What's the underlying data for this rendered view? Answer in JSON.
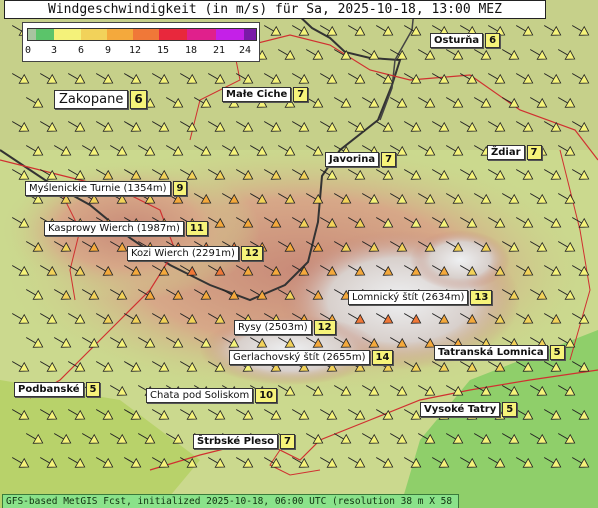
{
  "title": "Windgeschwindigkeit (in m/s) für Sa, 2025-10-18, 13:00 MEZ",
  "legend": {
    "ticks": [
      "0",
      "3",
      "6",
      "9",
      "12",
      "15",
      "18",
      "21",
      "24"
    ],
    "colors": [
      "#a8c4a0",
      "#5bc46a",
      "#f4f27a",
      "#f2d25a",
      "#f4a93c",
      "#f07838",
      "#e8283c",
      "#e0208c",
      "#c420e8",
      "#7a1aa8"
    ]
  },
  "places": [
    {
      "name": "Osturňa",
      "value": "6",
      "style": "bold"
    },
    {
      "name": "Zakopane",
      "value": "6",
      "style": "big"
    },
    {
      "name": "Małe Ciche",
      "value": "7",
      "style": "bold"
    },
    {
      "name": "Javorina",
      "value": "7",
      "style": "bold"
    },
    {
      "name": "Ždiar",
      "value": "7",
      "style": "bold"
    },
    {
      "name": "Myślenickie Turnie (1354m)",
      "value": "9",
      "style": "normal"
    },
    {
      "name": "Kasprowy Wierch (1987m)",
      "value": "11",
      "style": "normal"
    },
    {
      "name": "Kozi Wierch (2291m)",
      "value": "12",
      "style": "normal"
    },
    {
      "name": "Lomnický štít (2634m)",
      "value": "13",
      "style": "normal"
    },
    {
      "name": "Rysy (2503m)",
      "value": "12",
      "style": "normal"
    },
    {
      "name": "Gerlachovský štít (2655m)",
      "value": "14",
      "style": "normal"
    },
    {
      "name": "Tatranská Lomnica",
      "value": "5",
      "style": "bold"
    },
    {
      "name": "Podbanské",
      "value": "5",
      "style": "bold"
    },
    {
      "name": "Chata pod Soliskom",
      "value": "10",
      "style": "normal"
    },
    {
      "name": "Vysoké Tatry",
      "value": "5",
      "style": "bold"
    },
    {
      "name": "Štrbské Pleso",
      "value": "7",
      "style": "bold"
    }
  ],
  "footer": "GFS-based MetGIS Fcst, initialized 2025-10-18, 06:00 UTC  (resolution 38 m X 58 m)"
}
